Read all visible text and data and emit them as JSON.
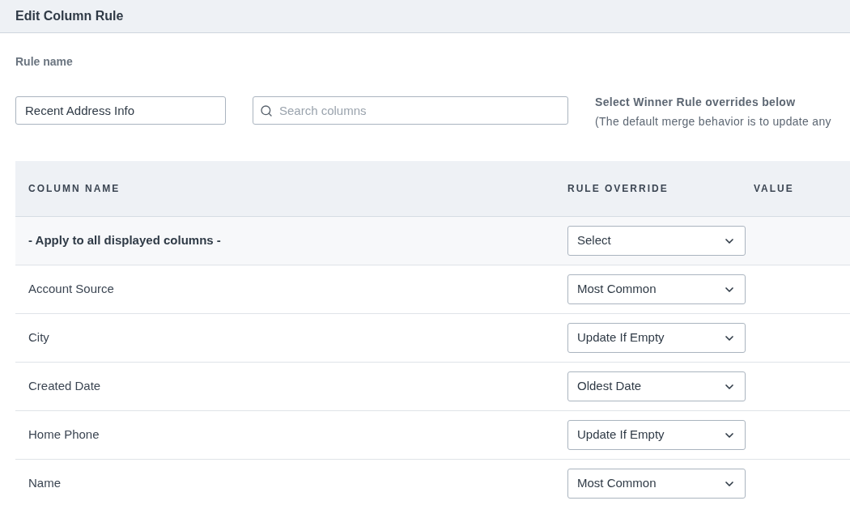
{
  "header": {
    "title": "Edit Column Rule"
  },
  "rule_name": {
    "label": "Rule name",
    "value": "Recent Address Info"
  },
  "search": {
    "placeholder": "Search columns"
  },
  "note": {
    "title": "Select Winner Rule overrides below",
    "text": "(The default merge behavior is to update any"
  },
  "table": {
    "columns": [
      "COLUMN NAME",
      "RULE OVERRIDE",
      "VALUE"
    ],
    "rows": [
      {
        "name": "- Apply to all displayed columns -",
        "override": "Select",
        "kind": "apply_all"
      },
      {
        "name": "Account Source",
        "override": "Most Common",
        "kind": "column"
      },
      {
        "name": "City",
        "override": "Update If Empty",
        "kind": "column"
      },
      {
        "name": "Created Date",
        "override": "Oldest Date",
        "kind": "column"
      },
      {
        "name": "Home Phone",
        "override": "Update If Empty",
        "kind": "column"
      },
      {
        "name": "Name",
        "override": "Most Common",
        "kind": "column"
      }
    ]
  }
}
